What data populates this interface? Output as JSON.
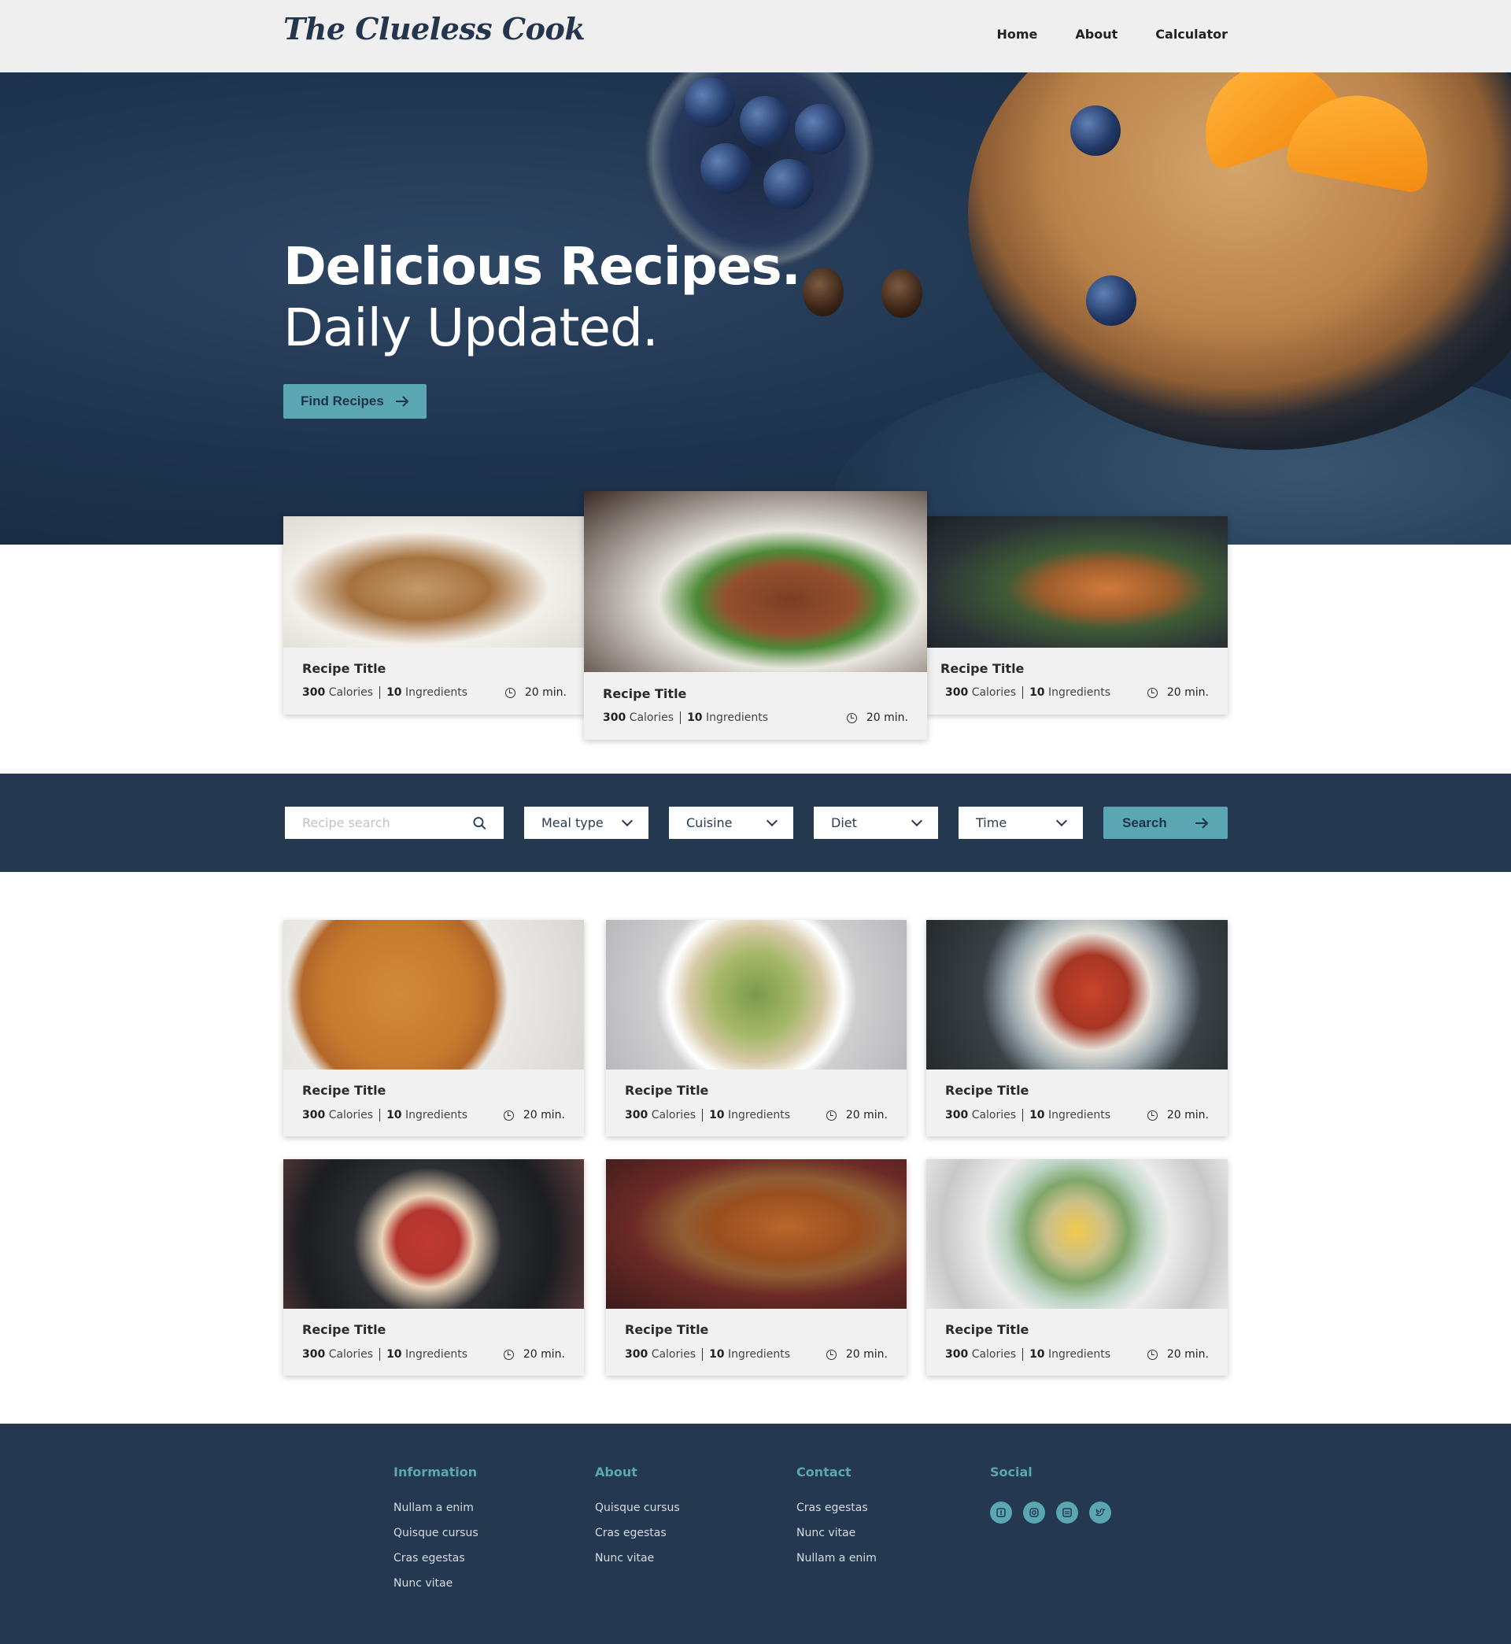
{
  "brand": {
    "logo": "The Clueless Cook"
  },
  "nav": {
    "items": [
      "Home",
      "About",
      "Calculator"
    ]
  },
  "hero": {
    "title": "Delicious Recipes.",
    "subtitle": "Daily Updated.",
    "cta_label": "Find Recipes",
    "cta_icon": "arrow-right-icon"
  },
  "featured": [
    {
      "title": "Recipe Title",
      "calories": "300",
      "calories_unit": "Calories",
      "ingredients": "10",
      "ingredients_unit": "Ingredients",
      "time": "20 min."
    },
    {
      "title": "Recipe Title",
      "calories": "300",
      "calories_unit": "Calories",
      "ingredients": "10",
      "ingredients_unit": "Ingredients",
      "time": "20 min."
    },
    {
      "title": "Recipe Title",
      "calories": "300",
      "calories_unit": "Calories",
      "ingredients": "10",
      "ingredients_unit": "Ingredients",
      "time": "20 min."
    }
  ],
  "search": {
    "placeholder": "Recipe search",
    "filters": [
      "Meal type",
      "Cuisine",
      "Diet",
      "Time"
    ],
    "button_label": "Search"
  },
  "recipes": [
    {
      "title": "Recipe Title",
      "calories": "300",
      "calories_unit": "Calories",
      "ingredients": "10",
      "ingredients_unit": "Ingredients",
      "time": "20 min."
    },
    {
      "title": "Recipe Title",
      "calories": "300",
      "calories_unit": "Calories",
      "ingredients": "10",
      "ingredients_unit": "Ingredients",
      "time": "20 min."
    },
    {
      "title": "Recipe Title",
      "calories": "300",
      "calories_unit": "Calories",
      "ingredients": "10",
      "ingredients_unit": "Ingredients",
      "time": "20 min."
    },
    {
      "title": "Recipe Title",
      "calories": "300",
      "calories_unit": "Calories",
      "ingredients": "10",
      "ingredients_unit": "Ingredients",
      "time": "20 min."
    },
    {
      "title": "Recipe Title",
      "calories": "300",
      "calories_unit": "Calories",
      "ingredients": "10",
      "ingredients_unit": "Ingredients",
      "time": "20 min."
    },
    {
      "title": "Recipe Title",
      "calories": "300",
      "calories_unit": "Calories",
      "ingredients": "10",
      "ingredients_unit": "Ingredients",
      "time": "20 min."
    }
  ],
  "footer": {
    "information": {
      "heading": "Information",
      "links": [
        "Nullam a enim",
        "Quisque cursus",
        "Cras egestas",
        "Nunc vitae"
      ]
    },
    "about": {
      "heading": "About",
      "links": [
        "Quisque cursus",
        "Cras egestas",
        "Nunc vitae"
      ]
    },
    "contact": {
      "heading": "Contact",
      "links": [
        "Cras egestas",
        "Nunc vitae",
        "Nullam a enim"
      ]
    },
    "social": {
      "heading": "Social",
      "icons": [
        "facebook-icon",
        "instagram-icon",
        "message-icon",
        "twitter-icon"
      ]
    }
  },
  "colors": {
    "accent": "#5aa7b3",
    "navy": "#24384f",
    "nav_bg": "#efefef"
  }
}
